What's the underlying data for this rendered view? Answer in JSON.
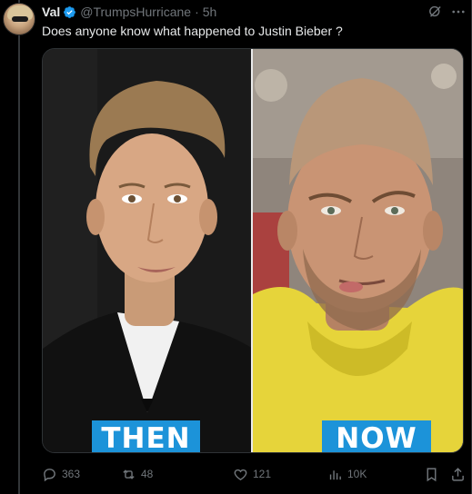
{
  "post": {
    "display_name": "Val",
    "handle": "@TrumpsHurricane",
    "separator": "·",
    "time_ago": "5h",
    "text": "Does anyone know what happened to Justin Bieber ?"
  },
  "media": {
    "left_caption": "THEN",
    "right_caption": "NOW",
    "caption_color": "#1c93d9"
  },
  "actions": {
    "replies": "363",
    "reposts": "48",
    "likes": "121",
    "views": "10K"
  },
  "icons": {
    "verified": "verified-badge-icon",
    "grok": "grok-icon",
    "more": "more-options-icon",
    "reply": "reply-icon",
    "repost": "repost-icon",
    "like": "heart-icon",
    "views": "views-chart-icon",
    "bookmark": "bookmark-icon",
    "share": "share-icon"
  },
  "colors": {
    "background": "#000000",
    "text_primary": "#e7e9ea",
    "text_secondary": "#71767b",
    "verified_blue": "#1d9bf0"
  }
}
